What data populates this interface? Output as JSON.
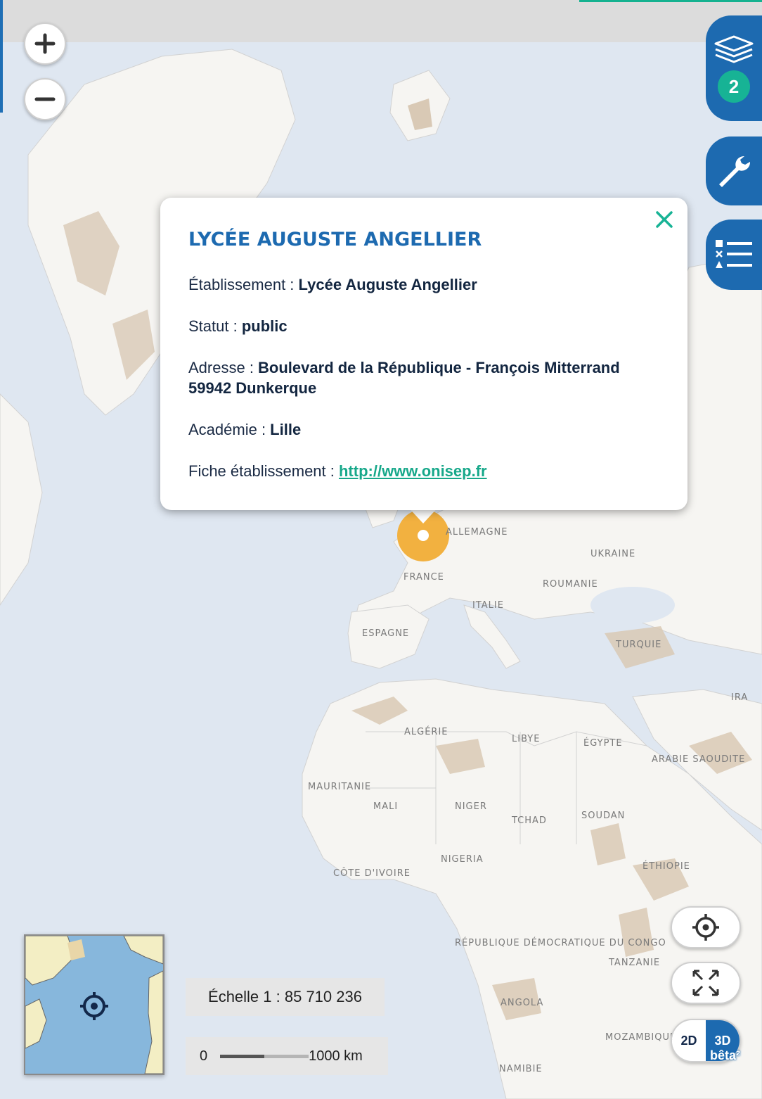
{
  "map": {
    "labels": {
      "allemagne": "ALLEMAGNE",
      "ukraine": "UKRAINE",
      "france": "FRANCE",
      "roumanie": "ROUMANIE",
      "italie": "ITALIE",
      "espagne": "ESPAGNE",
      "turquie": "TURQUIE",
      "ira": "IRA",
      "algerie": "ALGÉRIE",
      "libye": "LIBYE",
      "egypte": "ÉGYPTE",
      "arabie": "ARABIE SAOUDITE",
      "mauritanie": "MAURITANIE",
      "mali": "MALI",
      "niger": "NIGER",
      "tchad": "TCHAD",
      "soudan": "SOUDAN",
      "nigeria": "NIGERIA",
      "cote": "CÔTE D'IVOIRE",
      "ethiopie": "ÉTHIOPIE",
      "rdc": "RÉPUBLIQUE DÉMOCRATIQUE DU CONGO",
      "tanzanie": "TANZANIE",
      "angola": "ANGOLA",
      "mozambique": "MOZAMBIQUE",
      "namibie": "NAMIBIE"
    },
    "colors": {
      "sea": "#dfe7f1",
      "land": "#f6f5f2",
      "relief": "#d9c9b5",
      "marker": "#f2b140"
    }
  },
  "controls": {
    "zoom_in_icon": "plus-icon",
    "zoom_out_icon": "minus-icon",
    "layers_count": "2",
    "layers_icon": "layers-icon",
    "tools_icon": "wrench-icon",
    "legend_icon": "legend-icon",
    "locate_icon": "crosshair-icon",
    "fullscreen_icon": "expand-icon",
    "dim_2d": "2D",
    "dim_3d": "3D",
    "beta": "bêta²"
  },
  "popup": {
    "title": "LYCÉE AUGUSTE ANGELLIER",
    "etablissement_label": "Établissement : ",
    "etablissement_value": "Lycée Auguste Angellier",
    "statut_label": "Statut : ",
    "statut_value": "public",
    "adresse_label": "Adresse : ",
    "adresse_value_line1": "Boulevard de la République - François Mitterrand",
    "adresse_value_line2": "59942 Dunkerque",
    "academie_label": "Académie : ",
    "academie_value": "Lille",
    "fiche_label": "Fiche établissement : ",
    "fiche_link": "http://www.onisep.fr",
    "close_icon": "close-icon"
  },
  "scale": {
    "text": "Échelle 1 : 85 710 236",
    "bar_start": "0",
    "bar_end": "1000 km"
  },
  "overview": {
    "locate_icon": "crosshair-icon"
  }
}
